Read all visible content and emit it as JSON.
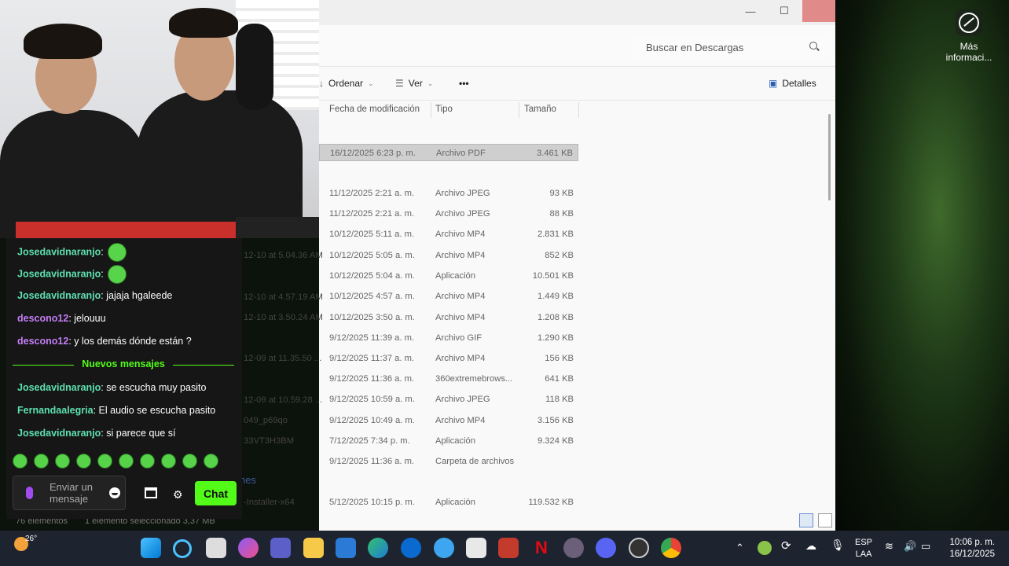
{
  "desktop": {
    "info_label": "Más informaci..."
  },
  "explorer": {
    "search_placeholder": "Buscar en Descargas",
    "toolbar": {
      "sort": "Ordenar",
      "view": "Ver",
      "more": "•••",
      "details": "Detalles"
    },
    "columns": [
      "Fecha de modificación",
      "Tipo",
      "Tamaño"
    ],
    "rows": [
      {
        "date": "16/12/2025 6:23 p. m.",
        "type": "Archivo PDF",
        "size": "3.461 KB",
        "selected": true
      },
      {
        "date": "11/12/2025 2:21 a. m.",
        "type": "Archivo JPEG",
        "size": "93 KB"
      },
      {
        "date": "11/12/2025 2:21 a. m.",
        "type": "Archivo JPEG",
        "size": "88 KB"
      },
      {
        "date": "10/12/2025 5:11 a. m.",
        "type": "Archivo MP4",
        "size": "2.831 KB"
      },
      {
        "date": "10/12/2025 5:05 a. m.",
        "type": "Archivo MP4",
        "size": "852 KB"
      },
      {
        "date": "10/12/2025 5:04 a. m.",
        "type": "Aplicación",
        "size": "10.501 KB"
      },
      {
        "date": "10/12/2025 4:57 a. m.",
        "type": "Archivo MP4",
        "size": "1.449 KB"
      },
      {
        "date": "10/12/2025 3:50 a. m.",
        "type": "Archivo MP4",
        "size": "1.208 KB"
      },
      {
        "date": "9/12/2025 11:39 a. m.",
        "type": "Archivo GIF",
        "size": "1.290 KB"
      },
      {
        "date": "9/12/2025 11:37 a. m.",
        "type": "Archivo MP4",
        "size": "156 KB"
      },
      {
        "date": "9/12/2025 11:36 a. m.",
        "type": "360extremebrows...",
        "size": "641 KB"
      },
      {
        "date": "9/12/2025 10:59 a. m.",
        "type": "Archivo JPEG",
        "size": "118 KB"
      },
      {
        "date": "9/12/2025 10:49 a. m.",
        "type": "Archivo MP4",
        "size": "3.156 KB"
      },
      {
        "date": "7/12/2025 7:34 p. m.",
        "type": "Aplicación",
        "size": "9.324 KB"
      },
      {
        "date": "9/12/2025 11:36 a. m.",
        "type": "Carpeta de archivos",
        "size": ""
      },
      {
        "date": "5/12/2025 10:15 p. m.",
        "type": "Aplicación",
        "size": "119.532 KB"
      }
    ],
    "partial_names": [
      "12-10 at 5.04.36 AM",
      "12-10 at 4.57.19 AM",
      "12-10 at 3.50.24 AM",
      "12-09 at 11.35.50 ...",
      "12-09 at 10.59.28 ...",
      "049_p69qo",
      "33VT3H3BM",
      "-Installer-x64"
    ],
    "section_partial": "nes",
    "status": {
      "count": "76 elementos",
      "selected": "1 elemento seleccionado 3,37 MB"
    }
  },
  "chat": {
    "messages": [
      {
        "user": "Josedavidnaranjo",
        "text": "",
        "color": "#5ee0b0",
        "emote": true
      },
      {
        "user": "Josedavidnaranjo",
        "text": "",
        "color": "#5ee0b0",
        "emote": true
      },
      {
        "user": "Josedavidnaranjo",
        "text": "jajaja hgaleede",
        "color": "#5ee0b0"
      },
      {
        "user": "descono12",
        "text": "jelouuu",
        "color": "#c57ef7"
      },
      {
        "user": "descono12",
        "text": "y los demás dónde están ?",
        "color": "#c57ef7"
      }
    ],
    "new_label": "Nuevos mensajes",
    "new_messages": [
      {
        "user": "Josedavidnaranjo",
        "text": "se escucha muy pasito",
        "color": "#5ee0b0"
      },
      {
        "user": "Fernandaalegria",
        "text": "El audio se escucha pasito",
        "color": "#5ee0b0"
      },
      {
        "user": "Josedavidnaranjo",
        "text": "si parece que sí",
        "color": "#5ee0b0"
      }
    ],
    "input_placeholder": "Enviar un mensaje",
    "chat_button": "Chat",
    "accent": "#53fc18"
  },
  "taskbar": {
    "temperature": "26°",
    "lang": "ESP",
    "layout": "LAA",
    "time": "10:06 p. m.",
    "date": "16/12/2025"
  }
}
